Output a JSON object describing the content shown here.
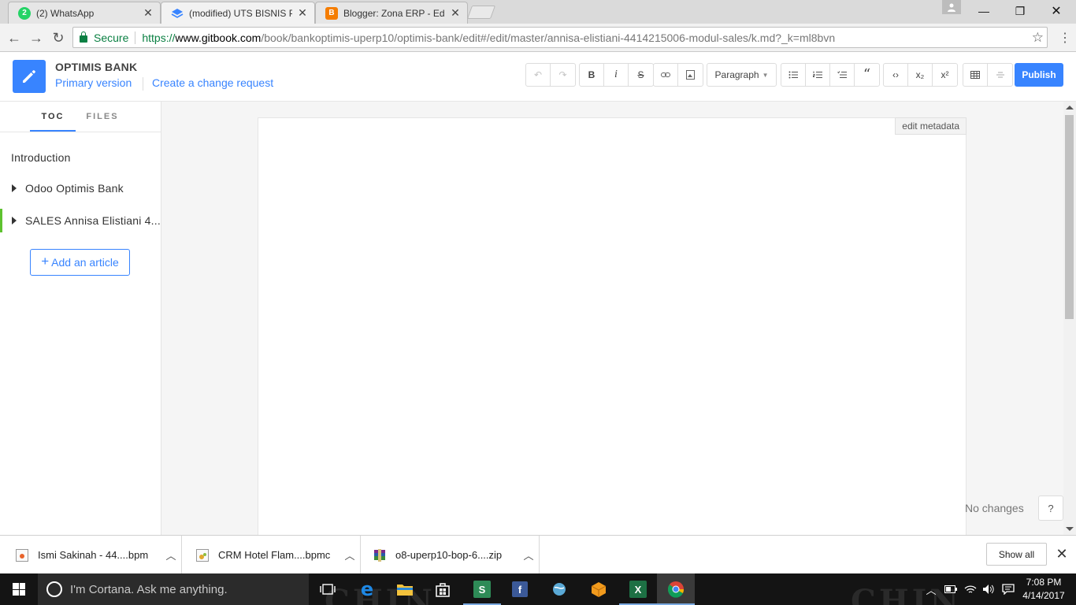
{
  "browser": {
    "tabs": [
      {
        "title": "(2) WhatsApp",
        "favicon": "whatsapp-icon",
        "color": "#25d366",
        "glyph": "2"
      },
      {
        "title": "(modified) UTS BISNIS PR",
        "favicon": "gitbook-icon",
        "color": "#3884ff",
        "glyph": ""
      },
      {
        "title": "Blogger: Zona ERP - Edit",
        "favicon": "blogger-icon",
        "color": "#f57d00",
        "glyph": "B"
      }
    ],
    "address": {
      "secure_label": "Secure",
      "scheme": "https://",
      "host": "www.gitbook.com",
      "path": "/book/bankoptimis-uperp10/optimis-bank/edit#/edit/master/annisa-elistiani-4414215006-modul-sales/k.md?_k=ml8bvn"
    }
  },
  "gitbook": {
    "book_title": "OPTIMIS BANK",
    "version_link": "Primary version",
    "change_request_link": "Create a change request",
    "paragraph_label": "Paragraph",
    "publish_label": "Publish",
    "toolbar": {
      "bold": "B",
      "italic": "i",
      "strike": "S",
      "code": "‹›",
      "subscript": "x₂",
      "superscript": "x²",
      "quote": "“"
    }
  },
  "sidebar": {
    "tabs": [
      "TOC",
      "FILES"
    ],
    "items": [
      {
        "label": "Introduction",
        "expandable": false,
        "active": false
      },
      {
        "label": "Odoo Optimis Bank",
        "expandable": true,
        "active": false
      },
      {
        "label": "SALES Annisa Elistiani 4...",
        "expandable": true,
        "active": true
      }
    ],
    "add_article_label": "Add an article"
  },
  "editor": {
    "metadata_button": "edit metadata",
    "status": "No changes",
    "help": "?"
  },
  "downloads": {
    "items": [
      {
        "name": "Ismi Sakinah - 44....bpm"
      },
      {
        "name": "CRM Hotel Flam....bpmc"
      },
      {
        "name": "o8-uperp10-bop-6....zip"
      }
    ],
    "show_all": "Show all"
  },
  "taskbar": {
    "cortana_placeholder": "I'm Cortana. Ask me anything.",
    "time": "7:08 PM",
    "date": "4/14/2017",
    "background_text": [
      "CHIN",
      "CHIN"
    ]
  }
}
